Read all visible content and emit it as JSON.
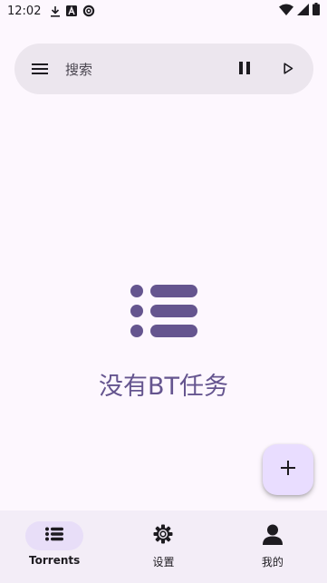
{
  "status_bar": {
    "time": "12:02",
    "icons": [
      "download-icon",
      "a-letter-icon",
      "sync-icon"
    ],
    "right_icons": [
      "wifi-icon",
      "signal-icon",
      "battery-icon"
    ]
  },
  "search_bar": {
    "placeholder": "搜索",
    "icons": [
      "menu-icon",
      "pause-icon",
      "play-icon"
    ]
  },
  "empty_state": {
    "message": "没有BT任务",
    "icon": "list-icon"
  },
  "fab": {
    "icon": "plus-icon"
  },
  "bottom_nav": {
    "items": [
      {
        "label": "Torrents",
        "icon": "list-icon",
        "active": true
      },
      {
        "label": "设置",
        "icon": "gear-icon",
        "active": false
      },
      {
        "label": "我的",
        "icon": "person-icon",
        "active": false
      }
    ]
  },
  "colors": {
    "background": "#fdf7fe",
    "accent": "#65558f",
    "search_bar": "#ece6ee",
    "fab": "#e9ddff",
    "nav_bar": "#f3edf7",
    "nav_indicator": "#e8def8"
  }
}
